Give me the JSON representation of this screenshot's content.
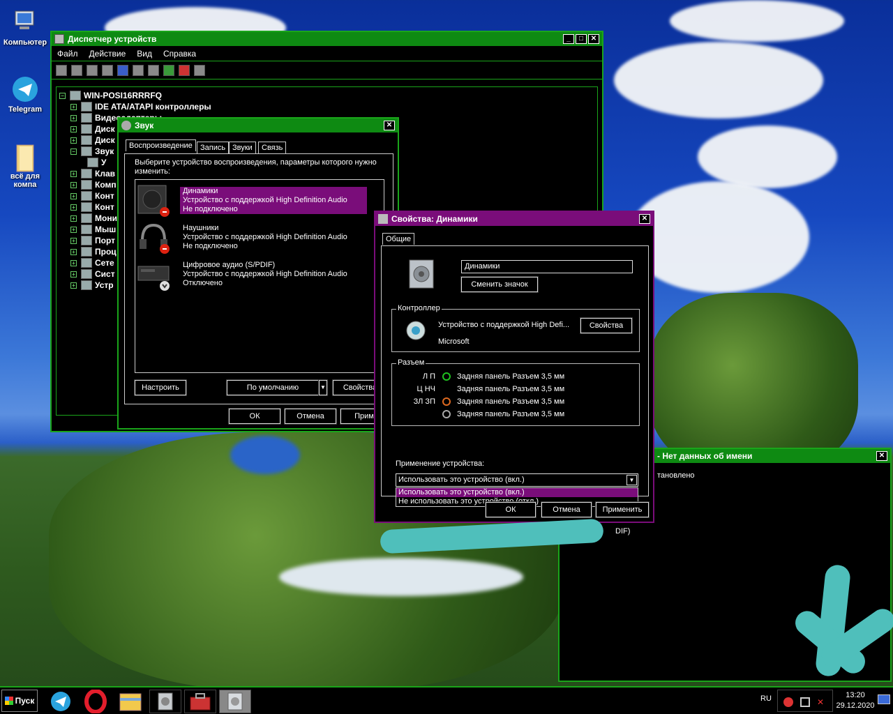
{
  "desktop": {
    "icons": [
      {
        "label": "Компьютер"
      },
      {
        "label": "Telegram"
      },
      {
        "label": "всё для компа"
      }
    ]
  },
  "devmgr": {
    "title": "Диспетчер устройств",
    "menu": [
      "Файл",
      "Действие",
      "Вид",
      "Справка"
    ],
    "root": "WIN-POSI16RRRFQ",
    "items": [
      "IDE ATA/ATAPI контроллеры",
      "Видеоадаптеры",
      "Диск",
      "Диск",
      "Звук",
      "У",
      "Клав",
      "Комп",
      "Конт",
      "Конт",
      "Мони",
      "Мыш",
      "Порт",
      "Проц",
      "Сете",
      "Сист",
      "Устр"
    ]
  },
  "sound": {
    "title": "Звук",
    "tabs": [
      "Воспроизведение",
      "Запись",
      "Звуки",
      "Связь"
    ],
    "prompt": "Выберите устройство воспроизведения, параметры которого нужно изменить:",
    "devices": [
      {
        "name": "Динамики",
        "desc": "Устройство с поддержкой High Definition Audio",
        "status": "Не подключено"
      },
      {
        "name": "Наушники",
        "desc": "Устройство с поддержкой High Definition Audio",
        "status": "Не подключено"
      },
      {
        "name": "Цифровое аудио (S/PDIF)",
        "desc": "Устройство с поддержкой High Definition Audio",
        "status": "Отключено"
      }
    ],
    "btn_configure": "Настроить",
    "btn_default": "По умолчанию",
    "btn_props": "Свойства",
    "btn_ok": "ОК",
    "btn_cancel": "Отмена",
    "btn_apply": "Приме"
  },
  "props": {
    "title": "Свойства: Динамики",
    "tab": "Общие",
    "name_value": "Динамики",
    "btn_change_icon": "Сменить значок",
    "controller_legend": "Контроллер",
    "controller_name": "Устройство с поддержкой High Defi...",
    "controller_vendor": "Microsoft",
    "btn_controller_props": "Свойства",
    "jack_legend": "Разъем",
    "jacks": [
      {
        "label": "Л П",
        "desc": "Задняя панель Разъем 3,5 мм",
        "color": "#1fc21f"
      },
      {
        "label": "Ц НЧ",
        "desc": "Задняя панель Разъем 3,5 мм",
        "color": ""
      },
      {
        "label": "ЗЛ ЗП",
        "desc": "Задняя панель Разъем 3,5 мм",
        "color": "#e06a20"
      },
      {
        "label": "",
        "desc": "Задняя панель Разъем 3,5 мм",
        "color": "#aaaaaa"
      }
    ],
    "usage_label": "Применение устройства:",
    "usage_value": "Использовать это устройство (вкл.)",
    "usage_options": [
      "Использовать это устройство (вкл.)",
      "Не использовать это устройство (откл.)"
    ],
    "btn_ok": "ОК",
    "btn_cancel": "Отмена",
    "btn_apply": "Применить"
  },
  "unknown_win": {
    "title": "- Нет данных об имени",
    "line1": "тановлено",
    "line2": "DIF)"
  },
  "taskbar": {
    "start": "Пуск",
    "lang": "RU",
    "time": "13:20",
    "date": "29.12.2020"
  }
}
